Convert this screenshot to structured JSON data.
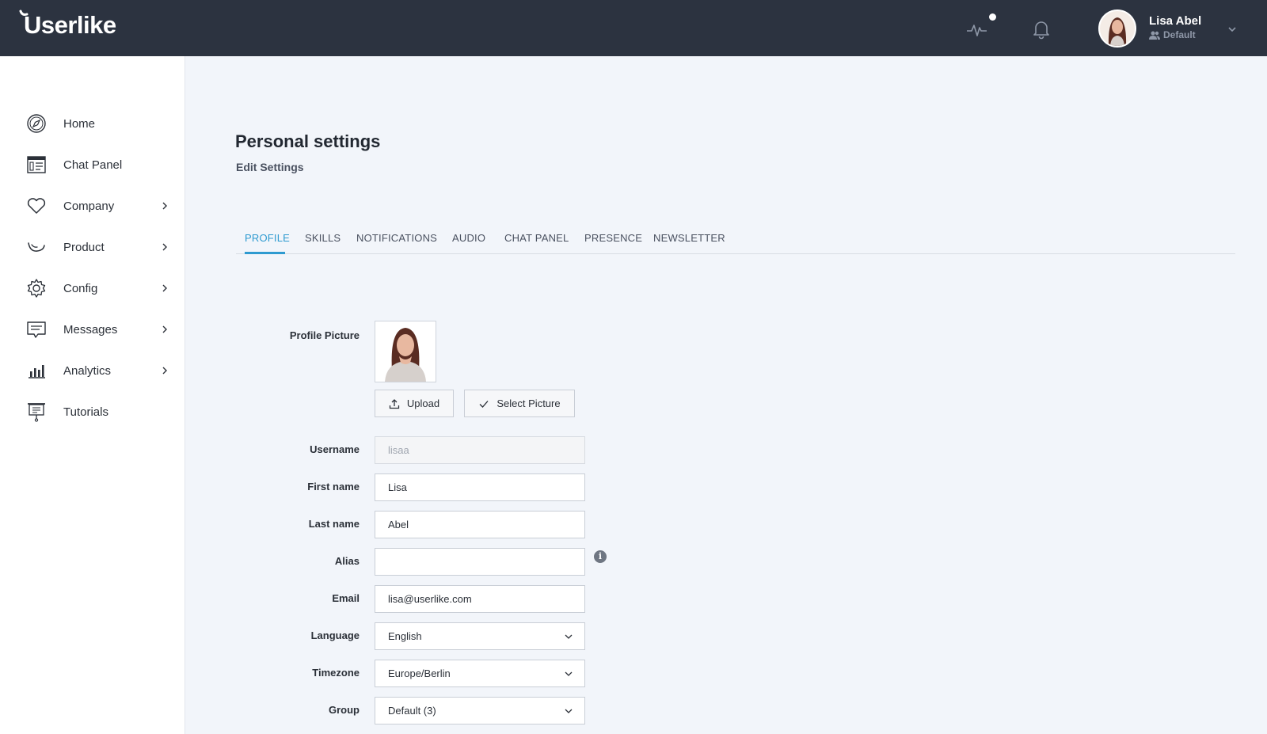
{
  "brand": {
    "logo_text": "Userlike"
  },
  "user": {
    "name": "Lisa Abel",
    "role": "Default"
  },
  "sidebar": {
    "items": [
      {
        "label": "Home",
        "icon": "compass-icon",
        "has_submenu": false
      },
      {
        "label": "Chat Panel",
        "icon": "chat-panel-icon",
        "has_submenu": false
      },
      {
        "label": "Company",
        "icon": "heart-icon",
        "has_submenu": true
      },
      {
        "label": "Product",
        "icon": "product-icon",
        "has_submenu": true
      },
      {
        "label": "Config",
        "icon": "gear-icon",
        "has_submenu": true
      },
      {
        "label": "Messages",
        "icon": "message-icon",
        "has_submenu": true
      },
      {
        "label": "Analytics",
        "icon": "bar-chart-icon",
        "has_submenu": true
      },
      {
        "label": "Tutorials",
        "icon": "presentation-icon",
        "has_submenu": false
      }
    ]
  },
  "page": {
    "title": "Personal settings",
    "subtitle": "Edit Settings"
  },
  "tabs": [
    {
      "label": "PROFILE",
      "active": true
    },
    {
      "label": "SKILLS",
      "active": false
    },
    {
      "label": "NOTIFICATIONS",
      "active": false
    },
    {
      "label": "AUDIO",
      "active": false
    },
    {
      "label": "CHAT PANEL",
      "active": false
    },
    {
      "label": "PRESENCE",
      "active": false
    },
    {
      "label": "NEWSLETTER",
      "active": false
    }
  ],
  "form": {
    "profile_picture_label": "Profile Picture",
    "upload_label": "Upload",
    "select_picture_label": "Select Picture",
    "username": {
      "label": "Username",
      "value": "lisaa"
    },
    "first_name": {
      "label": "First name",
      "value": "Lisa"
    },
    "last_name": {
      "label": "Last name",
      "value": "Abel"
    },
    "alias": {
      "label": "Alias",
      "value": ""
    },
    "email": {
      "label": "Email",
      "value": "lisa@userlike.com"
    },
    "language": {
      "label": "Language",
      "value": "English"
    },
    "timezone": {
      "label": "Timezone",
      "value": "Europe/Berlin"
    },
    "group": {
      "label": "Group",
      "value": "Default (3)"
    }
  },
  "colors": {
    "topbar": "#2c3340",
    "accent": "#2e9ad0",
    "background": "#f2f5fa"
  }
}
